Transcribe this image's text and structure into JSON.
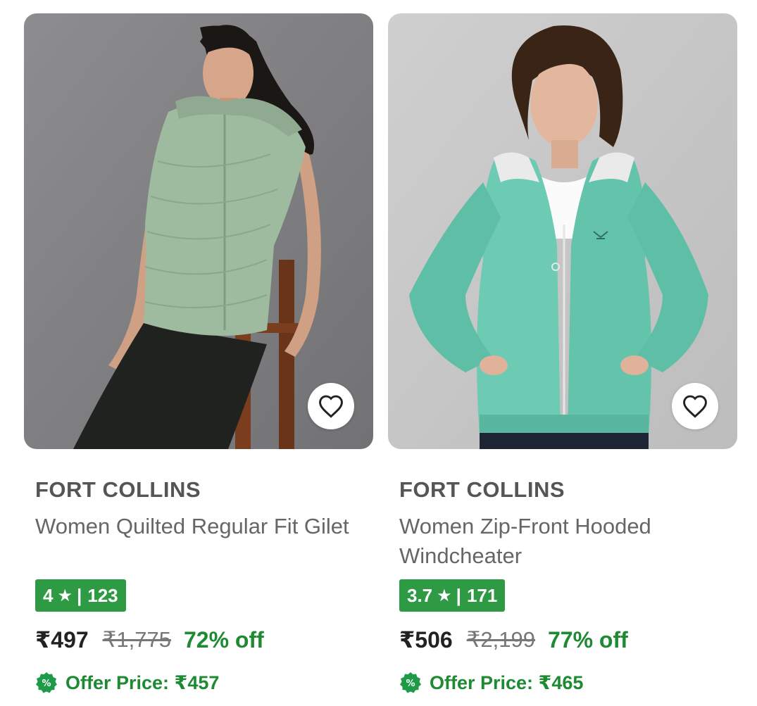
{
  "products": [
    {
      "brand": "FORT COLLINS",
      "title": "Women Quilted Regular Fit Gilet",
      "rating": "4",
      "rating_count": "123",
      "price": "₹497",
      "mrp": "₹1,775",
      "discount": "72% off",
      "offer_price": "Offer Price: ₹457"
    },
    {
      "brand": "FORT COLLINS",
      "title": "Women Zip-Front Hooded Windcheater",
      "rating": "3.7",
      "rating_count": "171",
      "price": "₹506",
      "mrp": "₹2,199",
      "discount": "77% off",
      "offer_price": "Offer Price: ₹465"
    }
  ],
  "icons": {
    "wishlist": "heart-outline-icon",
    "rating_star": "star-icon",
    "offer": "percent-badge-icon"
  },
  "colors": {
    "rating_bg": "#2e9b44",
    "discount": "#1e8a32",
    "brand_text": "#555555"
  }
}
